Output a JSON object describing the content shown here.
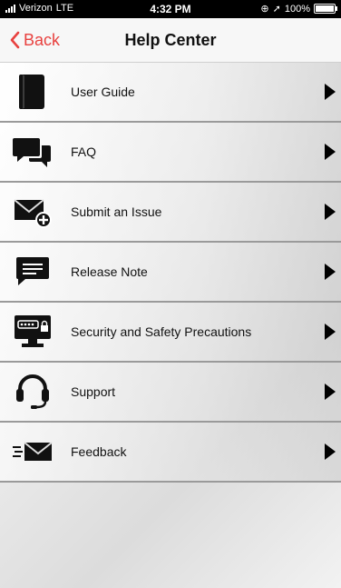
{
  "status": {
    "carrier": "Verizon",
    "network": "LTE",
    "time": "4:32 PM",
    "battery": "100%",
    "battery_level": 1.0
  },
  "nav": {
    "back_label": "Back",
    "title": "Help Center"
  },
  "menu": {
    "items": [
      {
        "label": "User Guide",
        "icon": "book-icon"
      },
      {
        "label": "FAQ",
        "icon": "chat-bubbles-icon"
      },
      {
        "label": "Submit an Issue",
        "icon": "mail-add-icon"
      },
      {
        "label": "Release Note",
        "icon": "message-icon"
      },
      {
        "label": "Security and Safety Precautions",
        "icon": "monitor-password-icon"
      },
      {
        "label": "Support",
        "icon": "headset-icon"
      },
      {
        "label": "Feedback",
        "icon": "send-mail-icon"
      }
    ]
  },
  "colors": {
    "accent": "#e8413f",
    "arrow": "#000000",
    "divider": "#9a9a9a"
  }
}
